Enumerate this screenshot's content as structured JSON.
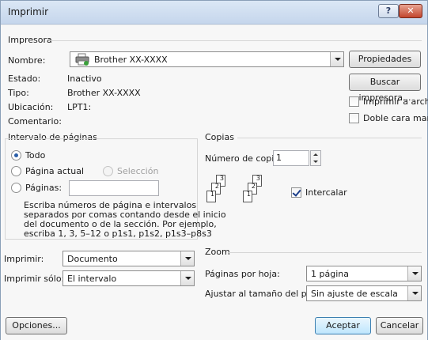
{
  "window": {
    "title": "Imprimir",
    "help_glyph": "?",
    "close_glyph": "✕"
  },
  "printer": {
    "group_label": "Impresora",
    "name_label": "Nombre:",
    "name_value": "Brother XX-XXXX",
    "status_label": "Estado:",
    "status_value": "Inactivo",
    "type_label": "Tipo:",
    "type_value": "Brother XX-XXXX",
    "location_label": "Ubicación:",
    "location_value": "LPT1:",
    "comment_label": "Comentario:",
    "comment_value": "",
    "properties_button": "Propiedades",
    "find_printer_button": "Buscar impresora...",
    "print_to_file_label": "Imprimir a archivo",
    "print_to_file_checked": false,
    "manual_duplex_label": "Doble cara manual",
    "manual_duplex_checked": false,
    "printer_icon": "printer-icon"
  },
  "page_range": {
    "group_label": "Intervalo de páginas",
    "all_label": "Todo",
    "all_selected": true,
    "current_page_label": "Página actual",
    "selection_label": "Selección",
    "pages_label": "Páginas:",
    "pages_value": "",
    "hint_lines": [
      "Escriba números de página e intervalos",
      "separados por comas contando desde el inicio",
      "del documento o de la sección. Por ejemplo,",
      "escriba 1, 3, 5–12 o p1s1, p1s2, p1s3–p8s3"
    ]
  },
  "copies": {
    "group_label": "Copias",
    "count_label": "Número de copias:",
    "count_value": "1",
    "collate_label": "Intercalar",
    "collate_checked": true,
    "stack_pages": [
      "3",
      "2",
      "1"
    ]
  },
  "print_what": {
    "label": "Imprimir:",
    "value": "Documento"
  },
  "print_only": {
    "label": "Imprimir sólo:",
    "value": "El intervalo"
  },
  "zoom": {
    "group_label": "Zoom",
    "pages_per_sheet_label": "Páginas por hoja:",
    "pages_per_sheet_value": "1 página",
    "scale_label": "Ajustar al tamaño del papel:",
    "scale_value": "Sin ajuste de escala"
  },
  "footer": {
    "options_button": "Opciones...",
    "ok_button": "Aceptar",
    "cancel_button": "Cancelar"
  },
  "colors": {
    "title_bar": "#c5d6ec",
    "close_button": "#c2452d",
    "dialog_bg": "#f7f7f7"
  }
}
